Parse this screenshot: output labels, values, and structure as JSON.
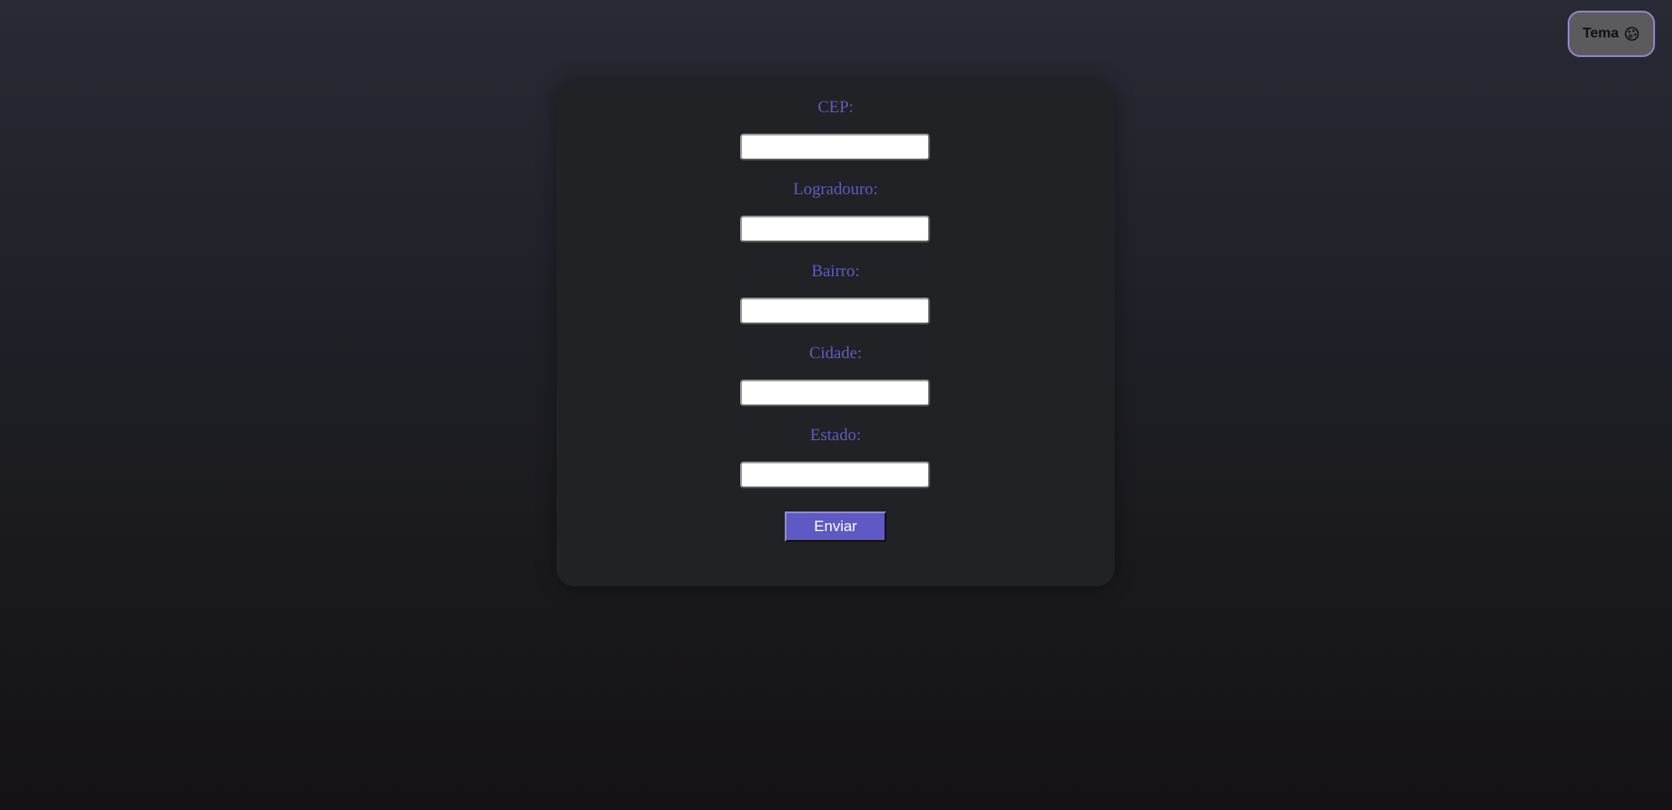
{
  "theme_toggle": {
    "label": "Tema",
    "icon": "palette-icon"
  },
  "form": {
    "fields": [
      {
        "label": "CEP:",
        "value": ""
      },
      {
        "label": "Logradouro:",
        "value": ""
      },
      {
        "label": "Bairro:",
        "value": ""
      },
      {
        "label": "Cidade:",
        "value": ""
      },
      {
        "label": "Estado:",
        "value": ""
      }
    ],
    "submit_label": "Enviar"
  },
  "colors": {
    "accent": "#5e59c4",
    "label": "#5f5ac8",
    "card_background": "#212225"
  }
}
